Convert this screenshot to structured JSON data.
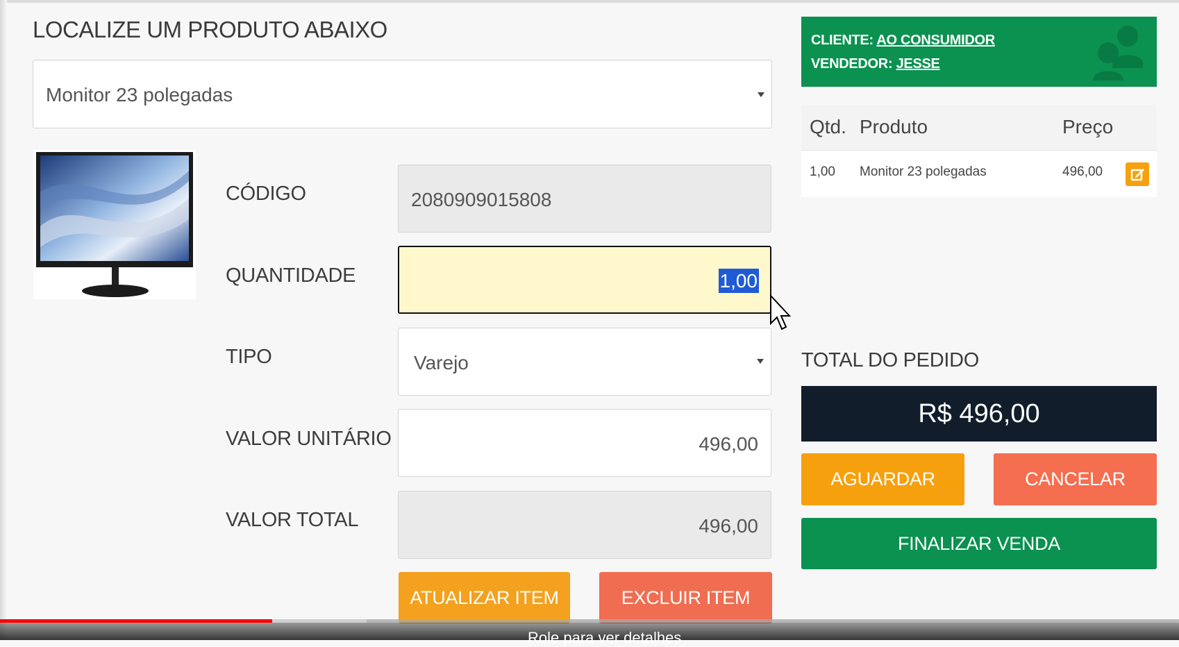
{
  "search": {
    "heading": "LOCALIZE UM PRODUTO ABAIXO",
    "selected_product": "Monitor 23 polegadas"
  },
  "form": {
    "codigo_label": "CÓDIGO",
    "codigo_value": "2080909015808",
    "quantidade_label": "QUANTIDADE",
    "quantidade_value": "1,00",
    "tipo_label": "TIPO",
    "tipo_value": "Varejo",
    "valor_unitario_label": "VALOR UNITÁRIO",
    "valor_unitario_value": "496,00",
    "valor_total_label": "VALOR TOTAL",
    "valor_total_value": "496,00",
    "atualizar_label": "ATUALIZAR ITEM",
    "excluir_label": "EXCLUIR ITEM"
  },
  "client": {
    "cliente_prefix": "CLIENTE:",
    "cliente_name": "AO CONSUMIDOR",
    "vendedor_prefix": "VENDEDOR:",
    "vendedor_name": "JESSE"
  },
  "items_table": {
    "headers": [
      "Qtd.",
      "Produto",
      "Preço"
    ],
    "rows": [
      {
        "qtd": "1,00",
        "produto": "Monitor 23 polegadas",
        "preco": "496,00"
      }
    ]
  },
  "order": {
    "total_label": "TOTAL DO PEDIDO",
    "total_value": "R$ 496,00",
    "aguardar_label": "AGUARDAR",
    "cancelar_label": "CANCELAR",
    "finalizar_label": "FINALIZAR VENDA"
  },
  "video": {
    "hint": "Role para ver detalhes",
    "progress": 0.231,
    "buffered": 0.311
  },
  "colors": {
    "green": "#0b9150",
    "orange": "#f5a10e",
    "salmon": "#f46e4f",
    "navy": "#111d2b",
    "qty_highlight": "#fff8cc"
  }
}
